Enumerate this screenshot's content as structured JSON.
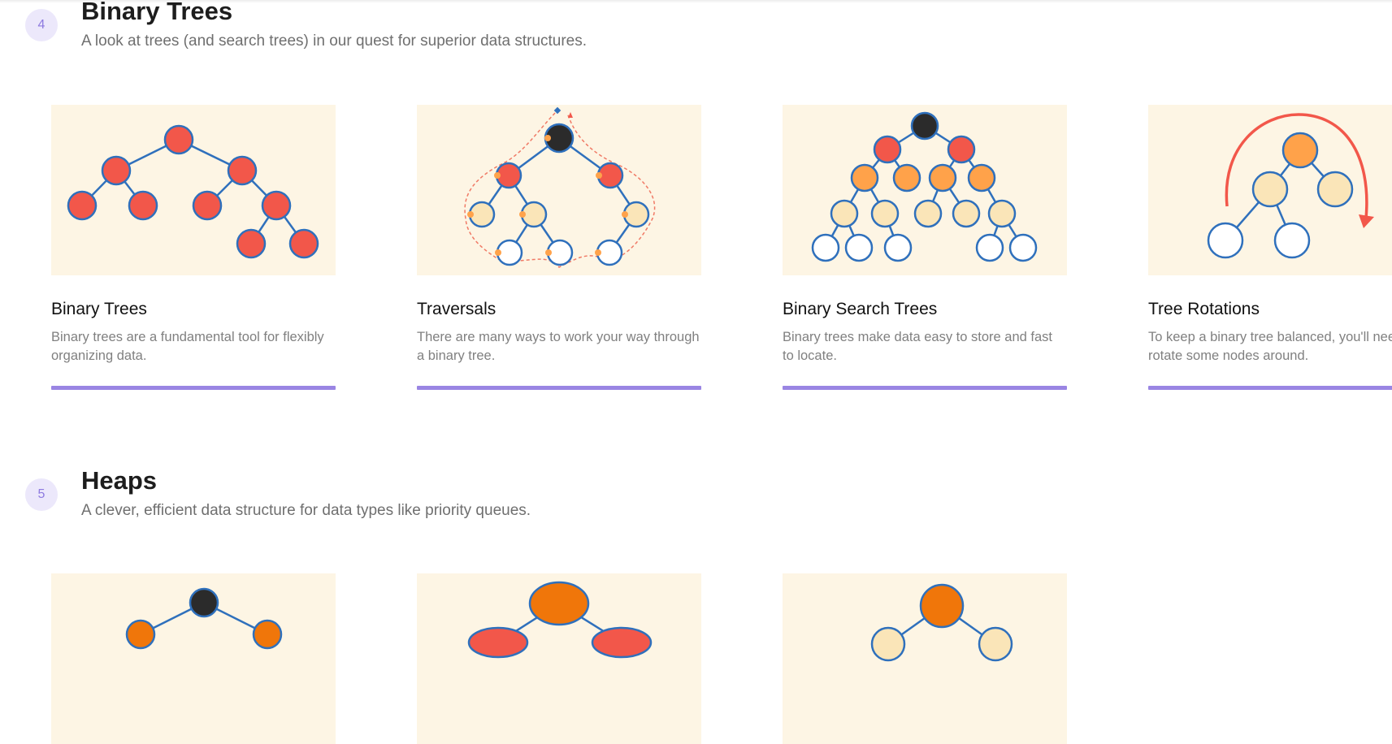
{
  "colors": {
    "accent": "#9a85e3",
    "badge_bg": "#ece8fb",
    "thumb_bg": "#fdf5e4",
    "node_red": "#f2574a",
    "node_orange": "#ffa24a",
    "node_beige": "#fae5b8",
    "node_dark": "#2b2b2b",
    "node_deep_orange": "#f0760a",
    "edge_blue": "#2f70bc"
  },
  "sections": [
    {
      "number": "4",
      "title": "Binary Trees",
      "subtitle": "A look at trees (and search trees) in our quest for superior data structures.",
      "cards": [
        {
          "title": "Binary Trees",
          "description": "Binary trees are a fundamental tool for flexibly organizing data.",
          "illustration": "binary-tree-illustration"
        },
        {
          "title": "Traversals",
          "description": "There are many ways to work your way through a binary tree.",
          "illustration": "traversal-illustration"
        },
        {
          "title": "Binary Search Trees",
          "description": "Binary trees make data easy to store and fast to locate.",
          "illustration": "binary-search-tree-illustration"
        },
        {
          "title": "Tree Rotations",
          "description": "To keep a binary tree balanced, you'll need to rotate some nodes around.",
          "illustration": "tree-rotation-illustration"
        }
      ]
    },
    {
      "number": "5",
      "title": "Heaps",
      "subtitle": "A clever, efficient data structure for data types like priority queues.",
      "cards": [
        {
          "illustration": "heap-illustration"
        },
        {
          "illustration": "heap-illustration"
        },
        {
          "illustration": "heap-illustration"
        }
      ]
    }
  ]
}
